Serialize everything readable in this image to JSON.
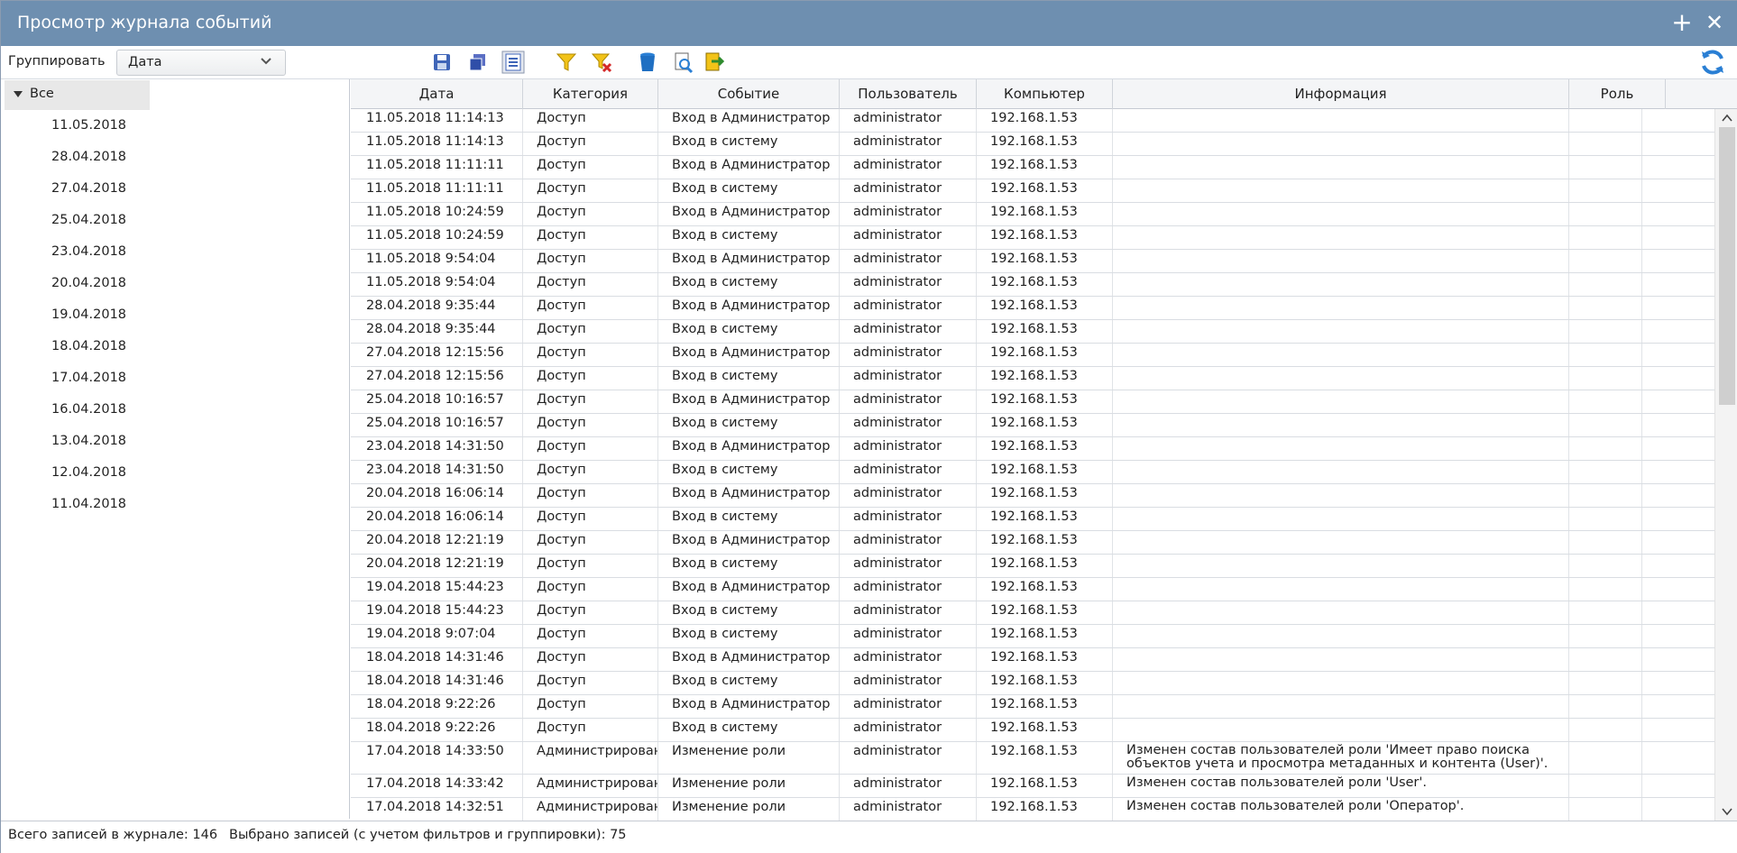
{
  "window": {
    "title": "Просмотр журнала событий",
    "add_glyph": "+",
    "close_glyph": "✕"
  },
  "toolbar": {
    "group_label": "Группировать",
    "group_value": "Дата",
    "icons": [
      "save-icon",
      "copy-icon",
      "report-icon",
      "filter-icon",
      "clear-filter-icon",
      "delete-icon",
      "preview-icon",
      "export-icon",
      "refresh-icon"
    ]
  },
  "tree": {
    "root_label": "Все",
    "dates": [
      "11.05.2018",
      "28.04.2018",
      "27.04.2018",
      "25.04.2018",
      "23.04.2018",
      "20.04.2018",
      "19.04.2018",
      "18.04.2018",
      "17.04.2018",
      "16.04.2018",
      "13.04.2018",
      "12.04.2018",
      "11.04.2018"
    ]
  },
  "table": {
    "columns": [
      "Дата",
      "Категория",
      "Событие",
      "Пользователь",
      "Компьютер",
      "Информация",
      "Роль"
    ],
    "rows": [
      [
        "11.05.2018 11:14:13",
        "Доступ",
        "Вход в Администратор",
        "administrator",
        "192.168.1.53",
        "",
        ""
      ],
      [
        "11.05.2018 11:14:13",
        "Доступ",
        "Вход в систему",
        "administrator",
        "192.168.1.53",
        "",
        ""
      ],
      [
        "11.05.2018 11:11:11",
        "Доступ",
        "Вход в Администратор",
        "administrator",
        "192.168.1.53",
        "",
        ""
      ],
      [
        "11.05.2018 11:11:11",
        "Доступ",
        "Вход в систему",
        "administrator",
        "192.168.1.53",
        "",
        ""
      ],
      [
        "11.05.2018 10:24:59",
        "Доступ",
        "Вход в Администратор",
        "administrator",
        "192.168.1.53",
        "",
        ""
      ],
      [
        "11.05.2018 10:24:59",
        "Доступ",
        "Вход в систему",
        "administrator",
        "192.168.1.53",
        "",
        ""
      ],
      [
        "11.05.2018 9:54:04",
        "Доступ",
        "Вход в Администратор",
        "administrator",
        "192.168.1.53",
        "",
        ""
      ],
      [
        "11.05.2018 9:54:04",
        "Доступ",
        "Вход в систему",
        "administrator",
        "192.168.1.53",
        "",
        ""
      ],
      [
        "28.04.2018 9:35:44",
        "Доступ",
        "Вход в Администратор",
        "administrator",
        "192.168.1.53",
        "",
        ""
      ],
      [
        "28.04.2018 9:35:44",
        "Доступ",
        "Вход в систему",
        "administrator",
        "192.168.1.53",
        "",
        ""
      ],
      [
        "27.04.2018 12:15:56",
        "Доступ",
        "Вход в Администратор",
        "administrator",
        "192.168.1.53",
        "",
        ""
      ],
      [
        "27.04.2018 12:15:56",
        "Доступ",
        "Вход в систему",
        "administrator",
        "192.168.1.53",
        "",
        ""
      ],
      [
        "25.04.2018 10:16:57",
        "Доступ",
        "Вход в Администратор",
        "administrator",
        "192.168.1.53",
        "",
        ""
      ],
      [
        "25.04.2018 10:16:57",
        "Доступ",
        "Вход в систему",
        "administrator",
        "192.168.1.53",
        "",
        ""
      ],
      [
        "23.04.2018 14:31:50",
        "Доступ",
        "Вход в Администратор",
        "administrator",
        "192.168.1.53",
        "",
        ""
      ],
      [
        "23.04.2018 14:31:50",
        "Доступ",
        "Вход в систему",
        "administrator",
        "192.168.1.53",
        "",
        ""
      ],
      [
        "20.04.2018 16:06:14",
        "Доступ",
        "Вход в Администратор",
        "administrator",
        "192.168.1.53",
        "",
        ""
      ],
      [
        "20.04.2018 16:06:14",
        "Доступ",
        "Вход в систему",
        "administrator",
        "192.168.1.53",
        "",
        ""
      ],
      [
        "20.04.2018 12:21:19",
        "Доступ",
        "Вход в Администратор",
        "administrator",
        "192.168.1.53",
        "",
        ""
      ],
      [
        "20.04.2018 12:21:19",
        "Доступ",
        "Вход в систему",
        "administrator",
        "192.168.1.53",
        "",
        ""
      ],
      [
        "19.04.2018 15:44:23",
        "Доступ",
        "Вход в Администратор",
        "administrator",
        "192.168.1.53",
        "",
        ""
      ],
      [
        "19.04.2018 15:44:23",
        "Доступ",
        "Вход в систему",
        "administrator",
        "192.168.1.53",
        "",
        ""
      ],
      [
        "19.04.2018 9:07:04",
        "Доступ",
        "Вход в систему",
        "administrator",
        "192.168.1.53",
        "",
        ""
      ],
      [
        "18.04.2018 14:31:46",
        "Доступ",
        "Вход в Администратор",
        "administrator",
        "192.168.1.53",
        "",
        ""
      ],
      [
        "18.04.2018 14:31:46",
        "Доступ",
        "Вход в систему",
        "administrator",
        "192.168.1.53",
        "",
        ""
      ],
      [
        "18.04.2018 9:22:26",
        "Доступ",
        "Вход в Администратор",
        "administrator",
        "192.168.1.53",
        "",
        ""
      ],
      [
        "18.04.2018 9:22:26",
        "Доступ",
        "Вход в систему",
        "administrator",
        "192.168.1.53",
        "",
        ""
      ],
      [
        "17.04.2018 14:33:50",
        "Администрирование",
        "Изменение роли",
        "administrator",
        "192.168.1.53",
        "Изменен состав пользователей роли 'Имеет право поиска объектов учета и просмотра метаданных и контента (User)'.",
        ""
      ],
      [
        "17.04.2018 14:33:42",
        "Администрирование",
        "Изменение роли",
        "administrator",
        "192.168.1.53",
        "Изменен состав пользователей роли 'User'.",
        ""
      ],
      [
        "17.04.2018 14:32:51",
        "Администрирование",
        "Изменение роли",
        "administrator",
        "192.168.1.53",
        "Изменен состав пользователей роли 'Оператор'.",
        ""
      ]
    ]
  },
  "status": {
    "total": "Всего записей в журнале: 146",
    "selected": "Выбрано записей (с учетом фильтров и группировки): 75"
  },
  "colors": {
    "titlebar": "#6e8fb0",
    "accent_blue": "#2a7fd4"
  }
}
